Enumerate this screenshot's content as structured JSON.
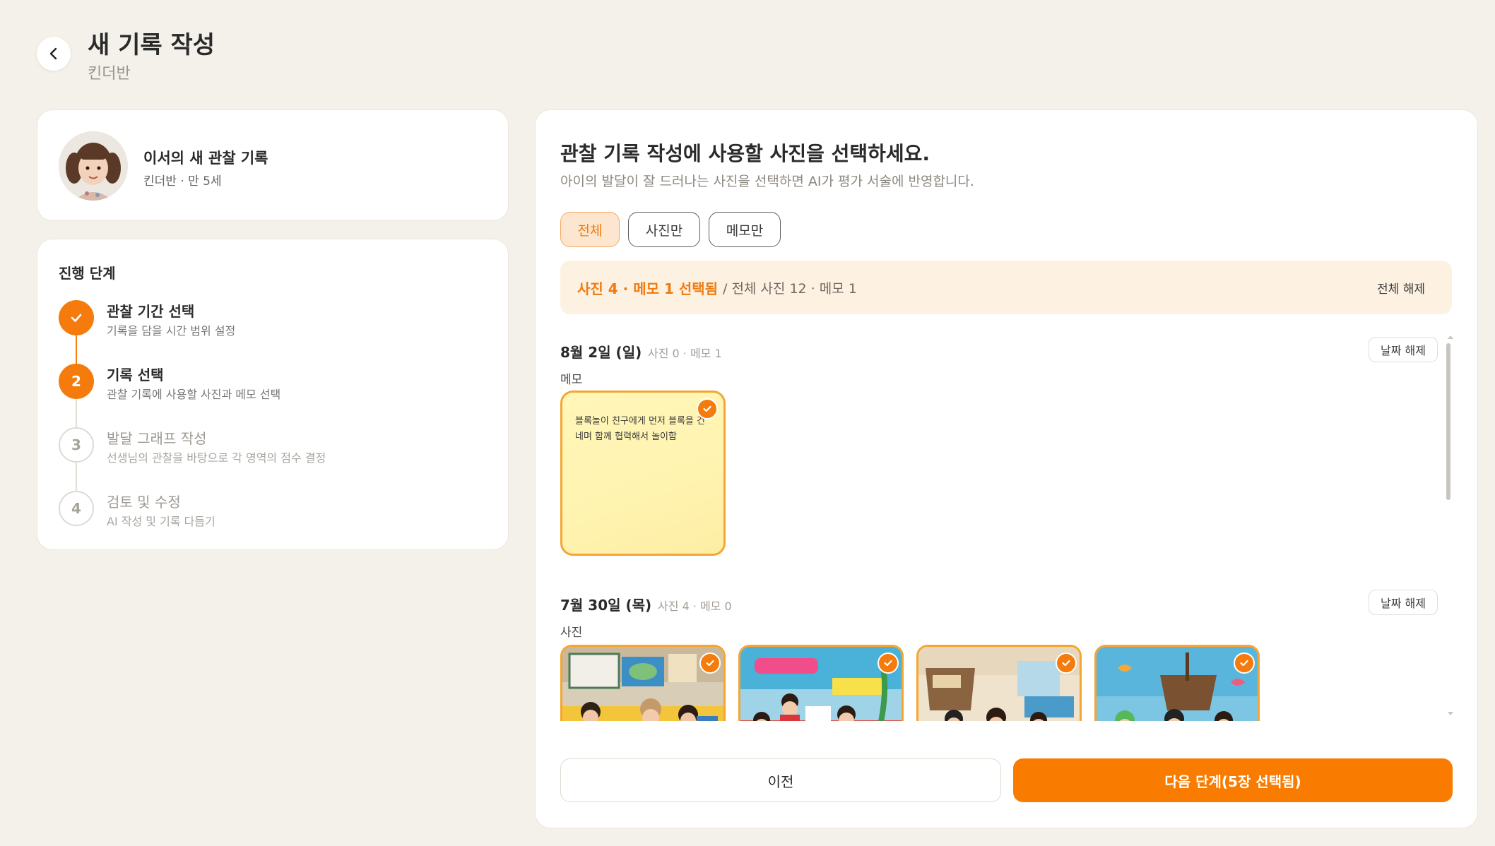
{
  "header": {
    "title": "새 기록 작성",
    "subtitle": "킨더반",
    "back_icon": "chevron-left-icon"
  },
  "profile": {
    "name": "이서의 새 관찰 기록",
    "meta": "킨더반 · 만 5세",
    "avatar_icon": "child-avatar"
  },
  "steps": {
    "title": "진행 단계",
    "items": [
      {
        "number": "",
        "title": "관찰 기간 선택",
        "desc": "기록을 담을 시간 범위 설정",
        "state": "done"
      },
      {
        "number": "2",
        "title": "기록 선택",
        "desc": "관찰 기록에 사용할 사진과 메모 선택",
        "state": "active"
      },
      {
        "number": "3",
        "title": "발달 그래프 작성",
        "desc": "선생님의 관찰을 바탕으로 각 영역의 점수 결정",
        "state": "todo"
      },
      {
        "number": "4",
        "title": "검토 및 수정",
        "desc": "AI 작성 및 기록 다듬기",
        "state": "todo"
      }
    ]
  },
  "main": {
    "title": "관찰 기록 작성에 사용할 사진을 선택하세요.",
    "desc": "아이의 발달이 잘 드러나는 사진을 선택하면 AI가 평가 서술에 반영합니다.",
    "filters": [
      "전체",
      "사진만",
      "메모만"
    ],
    "active_filter": "전체",
    "summary": {
      "selected": "사진 4 · 메모 1 선택됨",
      "total": "/ 전체 사진 12 · 메모 1",
      "clear_all": "전체 해제"
    },
    "groups": [
      {
        "date": "8월 2일 (일)",
        "meta": "사진 0 · 메모 1",
        "clear": "날짜 해제",
        "section": "메모",
        "memo": "블록놀이 친구에게 먼저 블록을 건네며 함께 협력해서 놀이함"
      },
      {
        "date": "7월 30일 (목)",
        "meta": "사진 4 · 메모 0",
        "clear": "날짜 해제",
        "section": "사진",
        "photos": [
          "classroom-photo",
          "reading-photo",
          "pirate-ship-photo",
          "ocean-backdrop-photo"
        ]
      }
    ],
    "prev_label": "이전",
    "next_label": "다음 단계(5장 선택됨)"
  },
  "colors": {
    "accent": "#f47b0c",
    "background": "#f4f1ea",
    "memo": "#fff3b0"
  }
}
